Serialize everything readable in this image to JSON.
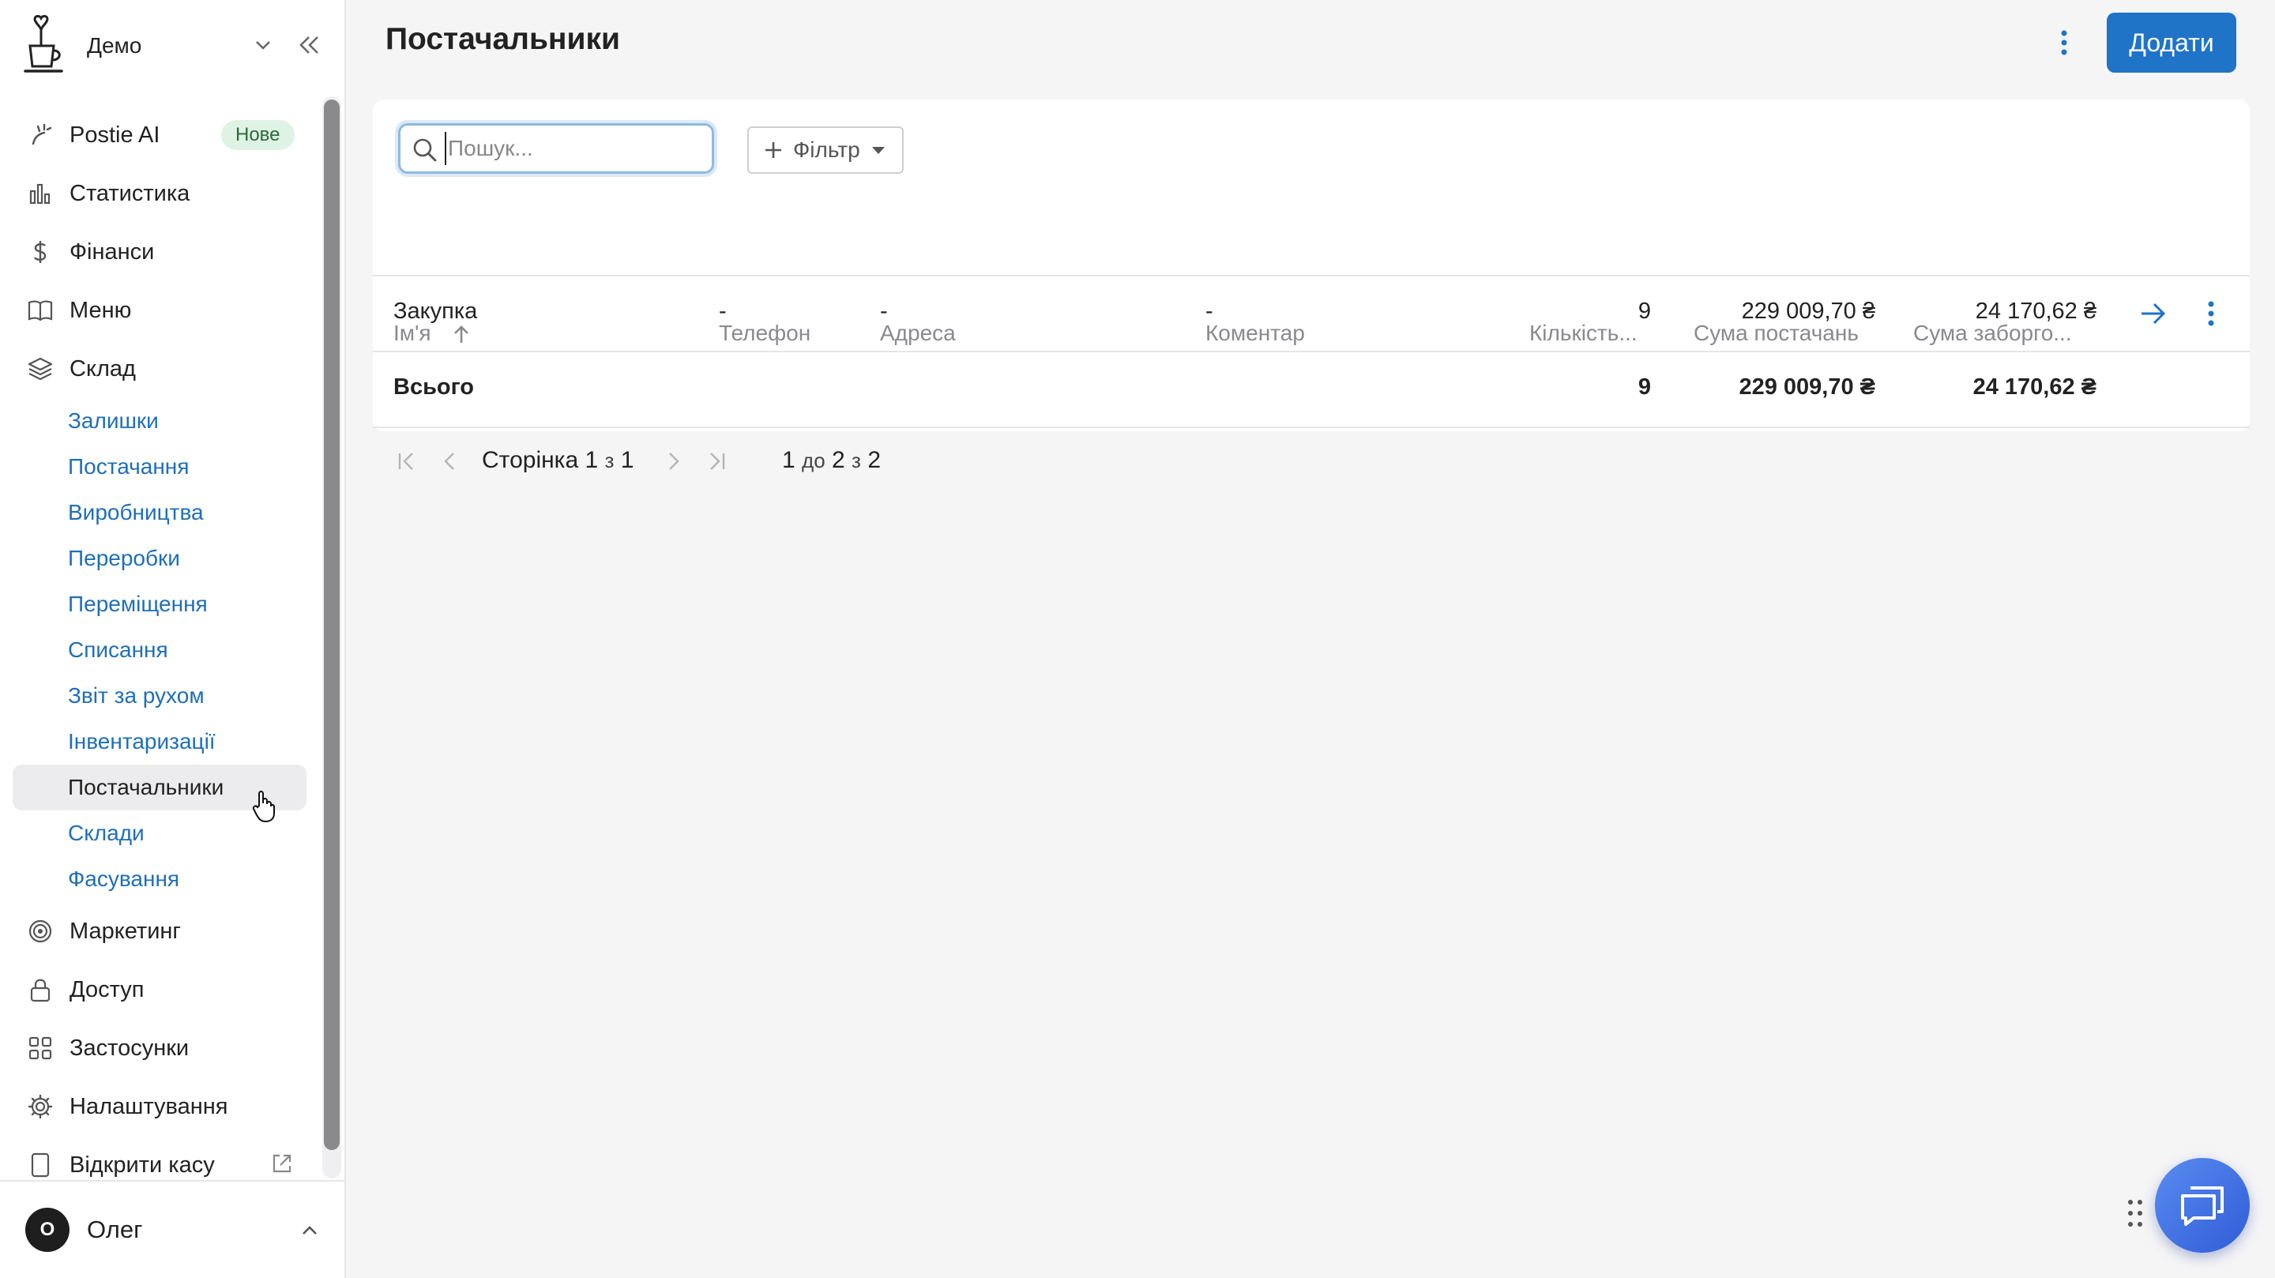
{
  "brand": {
    "name": "Демо"
  },
  "nav": {
    "items": [
      {
        "key": "postie",
        "label": "Postie AI",
        "badge": "Нове"
      },
      {
        "key": "stats",
        "label": "Статистика"
      },
      {
        "key": "finance",
        "label": "Фінанси"
      },
      {
        "key": "menu",
        "label": "Меню"
      },
      {
        "key": "warehouse",
        "label": "Склад"
      }
    ],
    "warehouse_sub": [
      "Залишки",
      "Постачання",
      "Виробництва",
      "Переробки",
      "Переміщення",
      "Списання",
      "Звіт за рухом",
      "Інвентаризації",
      "Постачальники",
      "Склади",
      "Фасування"
    ],
    "items_after": [
      {
        "key": "marketing",
        "label": "Маркетинг"
      },
      {
        "key": "access",
        "label": "Доступ"
      },
      {
        "key": "apps",
        "label": "Застосунки"
      },
      {
        "key": "settings",
        "label": "Налаштування"
      },
      {
        "key": "pos",
        "label": "Відкрити касу"
      }
    ]
  },
  "user": {
    "initial": "О",
    "name": "Олег"
  },
  "header": {
    "title": "Постачальники",
    "add_label": "Додати"
  },
  "toolbar": {
    "search_placeholder": "Пошук...",
    "filter_label": "Фільтр"
  },
  "table": {
    "columns": [
      "Ім'я",
      "Телефон",
      "Адреса",
      "Коментар",
      "Кількість...",
      "Сума постачань",
      "Сума заборго..."
    ],
    "rows": [
      {
        "name": "Закупка",
        "phone": "-",
        "address": "-",
        "comment": "-",
        "count": "9",
        "supply_sum": "229 009,70 ₴",
        "debt_sum": "24 170,62 ₴"
      }
    ],
    "total": {
      "label": "Всього",
      "count": "9",
      "supply_sum": "229 009,70 ₴",
      "debt_sum": "24 170,62 ₴"
    }
  },
  "pagination": {
    "page_word": "Сторінка",
    "page": "1",
    "of_word": "з",
    "pages": "1",
    "range_from": "1",
    "to_word": "до",
    "range_to": "2",
    "total": "2"
  },
  "colors": {
    "accent": "#1f74c7",
    "link": "#1f6fb8",
    "badge_bg": "#dff3e4",
    "chat": "#3f6ee0"
  }
}
